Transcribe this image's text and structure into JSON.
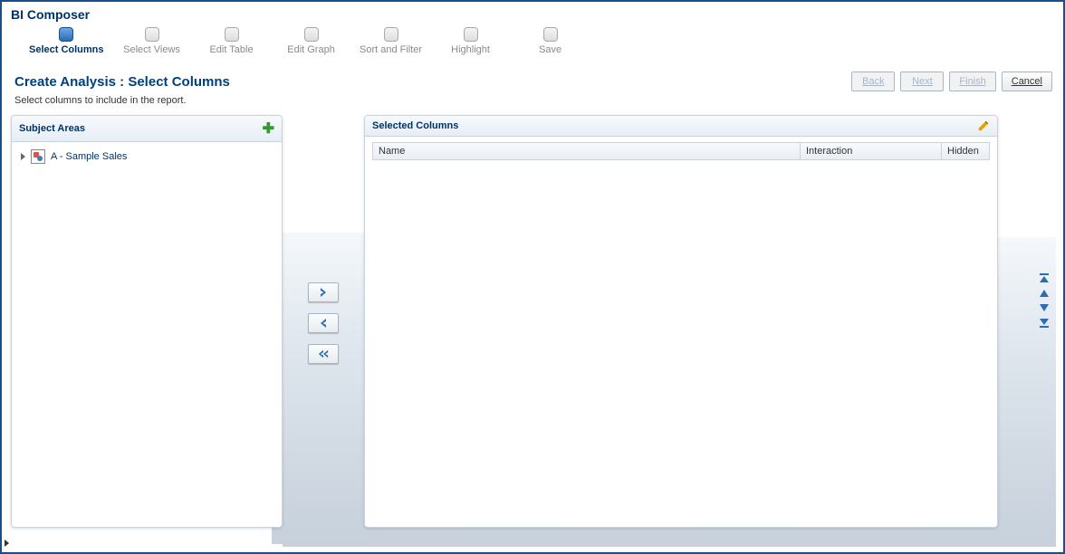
{
  "app_title": "BI Composer",
  "wizard": [
    {
      "label": "Select Columns",
      "active": true
    },
    {
      "label": "Select Views",
      "active": false
    },
    {
      "label": "Edit Table",
      "active": false
    },
    {
      "label": "Edit Graph",
      "active": false
    },
    {
      "label": "Sort and Filter",
      "active": false
    },
    {
      "label": "Highlight",
      "active": false
    },
    {
      "label": "Save",
      "active": false
    }
  ],
  "page_heading": "Create Analysis : Select Columns",
  "instruction": "Select columns to include in the report.",
  "nav_buttons": {
    "back": "Back",
    "next": "Next",
    "finish": "Finish",
    "cancel": "Cancel"
  },
  "subject_areas": {
    "title": "Subject Areas",
    "items": [
      {
        "label": "A - Sample Sales"
      }
    ]
  },
  "selected_columns": {
    "title": "Selected Columns",
    "headers": {
      "name": "Name",
      "interaction": "Interaction",
      "hidden": "Hidden"
    }
  }
}
